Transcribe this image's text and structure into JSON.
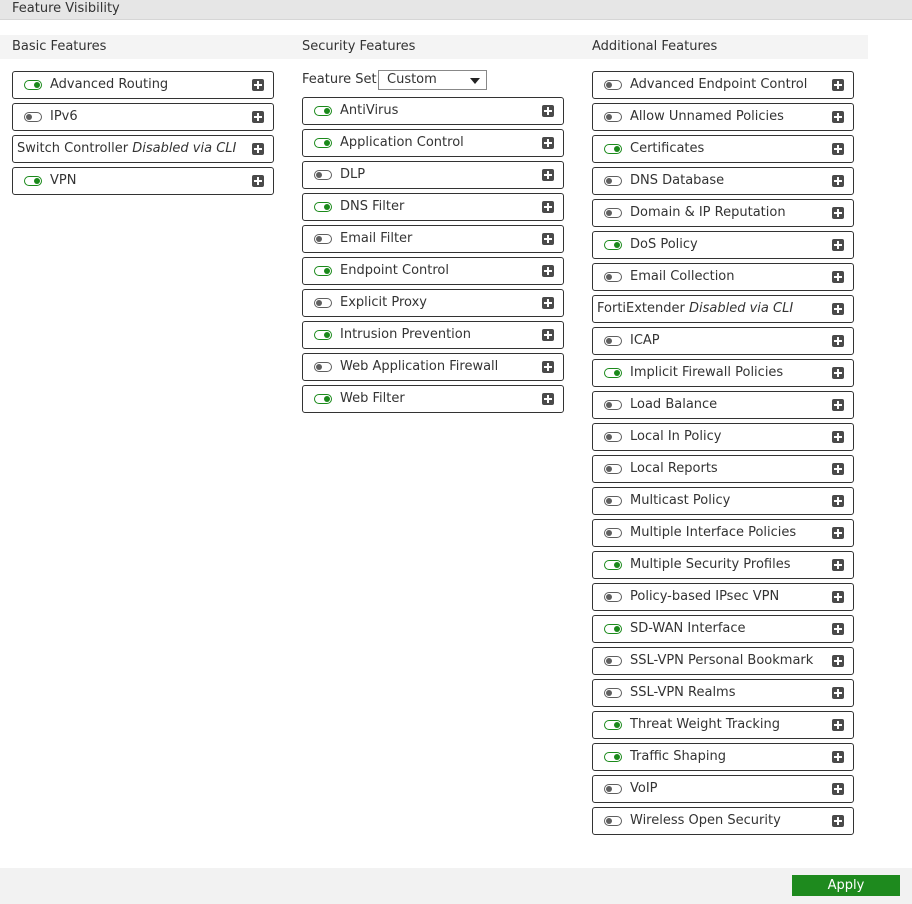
{
  "page": {
    "title": "Feature Visibility"
  },
  "basic": {
    "header": "Basic Features",
    "items": [
      {
        "label": "Advanced Routing",
        "state": "on"
      },
      {
        "label": "IPv6",
        "state": "off"
      },
      {
        "label": "Switch Controller",
        "note": "Disabled via CLI",
        "state": "cli"
      },
      {
        "label": "VPN",
        "state": "on"
      }
    ]
  },
  "security": {
    "header": "Security Features",
    "feature_set": {
      "label": "Feature Set:",
      "value": "Custom"
    },
    "items": [
      {
        "label": "AntiVirus",
        "state": "on"
      },
      {
        "label": "Application Control",
        "state": "on"
      },
      {
        "label": "DLP",
        "state": "off"
      },
      {
        "label": "DNS Filter",
        "state": "on"
      },
      {
        "label": "Email Filter",
        "state": "off"
      },
      {
        "label": "Endpoint Control",
        "state": "on"
      },
      {
        "label": "Explicit Proxy",
        "state": "off"
      },
      {
        "label": "Intrusion Prevention",
        "state": "on"
      },
      {
        "label": "Web Application Firewall",
        "state": "off"
      },
      {
        "label": "Web Filter",
        "state": "on"
      }
    ]
  },
  "additional": {
    "header": "Additional Features",
    "items": [
      {
        "label": "Advanced Endpoint Control",
        "state": "off"
      },
      {
        "label": "Allow Unnamed Policies",
        "state": "off"
      },
      {
        "label": "Certificates",
        "state": "on"
      },
      {
        "label": "DNS Database",
        "state": "off"
      },
      {
        "label": "Domain & IP Reputation",
        "state": "off"
      },
      {
        "label": "DoS Policy",
        "state": "on"
      },
      {
        "label": "Email Collection",
        "state": "off"
      },
      {
        "label": "FortiExtender",
        "note": "Disabled via CLI",
        "state": "cli"
      },
      {
        "label": "ICAP",
        "state": "off"
      },
      {
        "label": "Implicit Firewall Policies",
        "state": "on"
      },
      {
        "label": "Load Balance",
        "state": "off"
      },
      {
        "label": "Local In Policy",
        "state": "off"
      },
      {
        "label": "Local Reports",
        "state": "off"
      },
      {
        "label": "Multicast Policy",
        "state": "off"
      },
      {
        "label": "Multiple Interface Policies",
        "state": "off"
      },
      {
        "label": "Multiple Security Profiles",
        "state": "on"
      },
      {
        "label": "Policy-based IPsec VPN",
        "state": "off"
      },
      {
        "label": "SD-WAN Interface",
        "state": "on"
      },
      {
        "label": "SSL-VPN Personal Bookmark",
        "state": "off"
      },
      {
        "label": "SSL-VPN Realms",
        "state": "off"
      },
      {
        "label": "Threat Weight Tracking",
        "state": "on"
      },
      {
        "label": "Traffic Shaping",
        "state": "on"
      },
      {
        "label": "VoIP",
        "state": "off"
      },
      {
        "label": "Wireless Open Security",
        "state": "off"
      }
    ]
  },
  "footer": {
    "apply_label": "Apply"
  },
  "colors": {
    "toggle_on": "#1b8a1b",
    "toggle_off": "#5f5f5f",
    "apply_bg": "#1e8a1e"
  }
}
